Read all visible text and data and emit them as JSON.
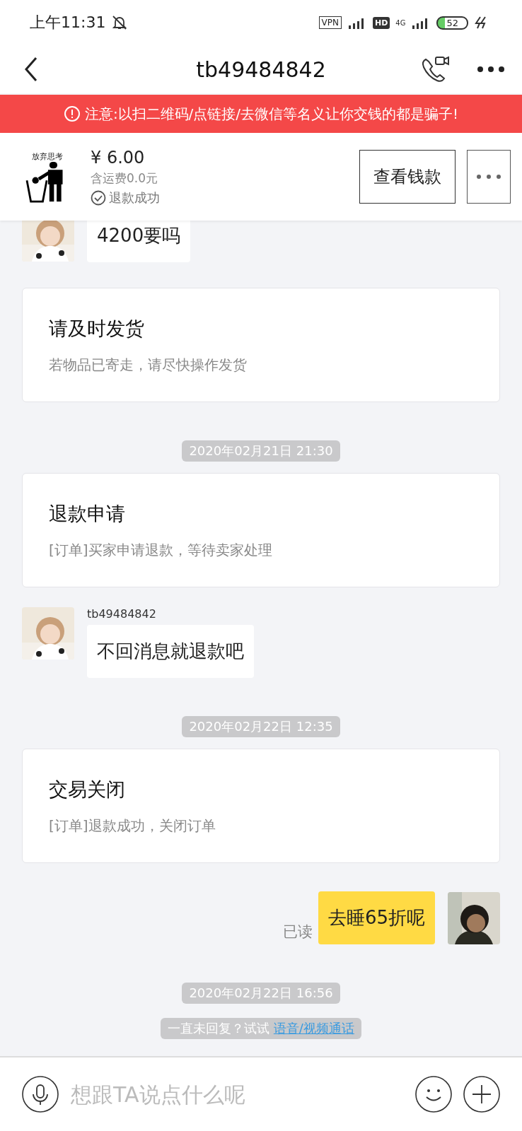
{
  "status_bar": {
    "time": "上午11:31",
    "vpn": "VPN",
    "hd": "HD",
    "network": "4G",
    "battery": "52"
  },
  "nav": {
    "title": "tb49484842"
  },
  "warning": {
    "text": "注意:以扫二维码/点链接/去微信等名义让你交钱的都是骗子!"
  },
  "order": {
    "thumbnail_caption": "放弃思考",
    "price": "¥ 6.00",
    "shipping": "含运费0.0元",
    "status": "退款成功",
    "button": "查看钱款"
  },
  "messages": [
    {
      "kind": "text",
      "outgoing": false,
      "text": "4200要吗"
    },
    {
      "kind": "card",
      "title": "请及时发货",
      "body": "若物品已寄走，请尽快操作发货"
    },
    {
      "kind": "time",
      "text": "2020年02月21日 21:30"
    },
    {
      "kind": "card",
      "title": "退款申请",
      "body": "[订单]买家申请退款，等待卖家处理"
    },
    {
      "kind": "text",
      "outgoing": false,
      "sender": "tb49484842",
      "text": "不回消息就退款吧"
    },
    {
      "kind": "time",
      "text": "2020年02月22日 12:35"
    },
    {
      "kind": "card",
      "title": "交易关闭",
      "body": "[订单]退款成功，关闭订单"
    },
    {
      "kind": "text",
      "outgoing": true,
      "text": "去睡65折呢",
      "read": "已读"
    },
    {
      "kind": "time",
      "text": "2020年02月22日 16:56"
    },
    {
      "kind": "hint",
      "text": "一直未回复？试试 ",
      "link": "语音/视频通话"
    }
  ],
  "input": {
    "placeholder": "想跟TA说点什么呢"
  }
}
